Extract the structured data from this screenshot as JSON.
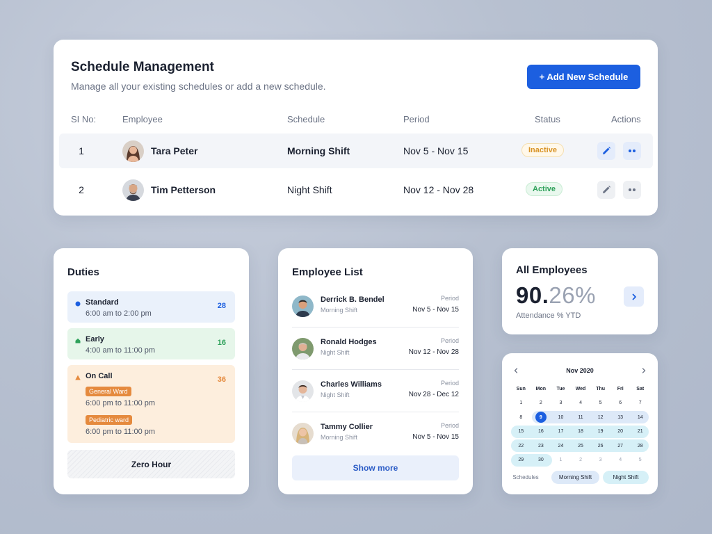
{
  "schedule": {
    "title": "Schedule Management",
    "subtitle": "Manage all your existing schedules or add a new schedule.",
    "add_button": "+ Add New Schedule",
    "columns": [
      "SI No:",
      "Employee",
      "Schedule",
      "Period",
      "Status",
      "Actions"
    ],
    "rows": [
      {
        "num": "1",
        "employee": "Tara Peter",
        "schedule": "Morning Shift",
        "period": "Nov 5 - Nov 15",
        "status": "Inactive"
      },
      {
        "num": "2",
        "employee": "Tim Petterson",
        "schedule": "Night Shift",
        "period": "Nov 12 - Nov 28",
        "status": "Active"
      }
    ]
  },
  "duties": {
    "title": "Duties",
    "items": [
      {
        "name": "Standard",
        "time": "6:00 am to 2:00 pm",
        "count": "28",
        "color": "#1c5fe0",
        "bg": "#eaf1fb"
      },
      {
        "name": "Early",
        "time": "4:00 am to 11:00 pm",
        "count": "16",
        "color": "#2ea15a",
        "bg": "#e6f6ea"
      },
      {
        "name": "On Call",
        "count": "36",
        "color": "#e58a3e",
        "bg": "#fdeedd",
        "tags": [
          {
            "label": "General Ward",
            "time": "6:00 pm to 11:00 pm"
          },
          {
            "label": "Pediatric ward",
            "time": "6:00 pm to 11:00 pm"
          }
        ]
      }
    ],
    "zero_hour": "Zero Hour"
  },
  "employee_list": {
    "title": "Employee List",
    "period_label": "Period",
    "items": [
      {
        "name": "Derrick B. Bendel",
        "shift": "Morning Shift",
        "period": "Nov 5 - Nov 15"
      },
      {
        "name": "Ronald Hodges",
        "shift": "Night Shift",
        "period": "Nov 12 - Nov 28"
      },
      {
        "name": "Charles Williams",
        "shift": "Night Shift",
        "period": "Nov 28 - Dec 12"
      },
      {
        "name": "Tammy Collier",
        "shift": "Morning Shift",
        "period": "Nov 5 - Nov 15"
      }
    ],
    "show_more": "Show more"
  },
  "all_employees": {
    "title": "All Employees",
    "value_main": "90.",
    "value_frac": "26%",
    "caption": "Attendance % YTD"
  },
  "calendar": {
    "month": "Nov 2020",
    "weekdays": [
      "Sun",
      "Mon",
      "Tue",
      "Wed",
      "Thu",
      "Fri",
      "Sat"
    ],
    "weeks": [
      [
        "1",
        "2",
        "3",
        "4",
        "5",
        "6",
        "7"
      ],
      [
        "8",
        "9",
        "10",
        "11",
        "12",
        "13",
        "14"
      ],
      [
        "15",
        "16",
        "17",
        "18",
        "19",
        "20",
        "21"
      ],
      [
        "22",
        "23",
        "24",
        "25",
        "26",
        "27",
        "28"
      ],
      [
        "29",
        "30",
        "1",
        "2",
        "3",
        "4",
        "5"
      ]
    ],
    "selected_day": "9",
    "legend_label": "Schedules",
    "legend_morning": "Morning Shift",
    "legend_night": "Night Shift"
  }
}
